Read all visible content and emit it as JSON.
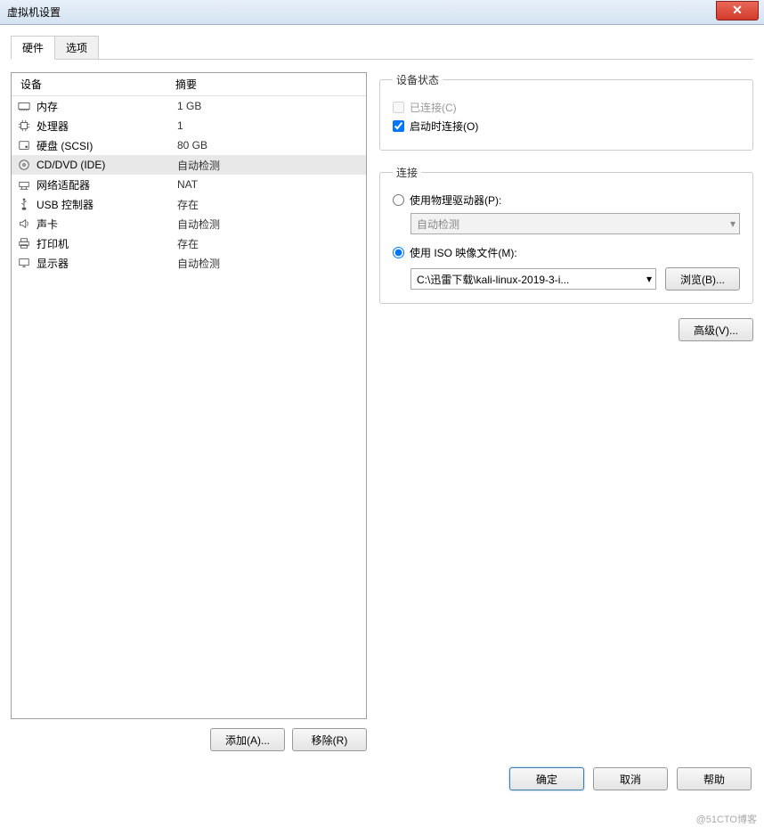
{
  "window": {
    "title": "虚拟机设置"
  },
  "tabs": {
    "hardware": "硬件",
    "options": "选项"
  },
  "hw_list": {
    "header_device": "设备",
    "header_summary": "摘要",
    "items": [
      {
        "icon": "memory",
        "name": "内存",
        "summary": "1 GB"
      },
      {
        "icon": "cpu",
        "name": "处理器",
        "summary": "1"
      },
      {
        "icon": "disk",
        "name": "硬盘 (SCSI)",
        "summary": "80 GB"
      },
      {
        "icon": "cd",
        "name": "CD/DVD (IDE)",
        "summary": "自动检测",
        "selected": true
      },
      {
        "icon": "net",
        "name": "网络适配器",
        "summary": "NAT"
      },
      {
        "icon": "usb",
        "name": "USB 控制器",
        "summary": "存在"
      },
      {
        "icon": "sound",
        "name": "声卡",
        "summary": "自动检测"
      },
      {
        "icon": "printer",
        "name": "打印机",
        "summary": "存在"
      },
      {
        "icon": "display",
        "name": "显示器",
        "summary": "自动检测"
      }
    ]
  },
  "buttons": {
    "add": "添加(A)...",
    "remove": "移除(R)",
    "browse": "浏览(B)...",
    "advanced": "高级(V)...",
    "ok": "确定",
    "cancel": "取消",
    "help": "帮助"
  },
  "device_status": {
    "legend": "设备状态",
    "connected": "已连接(C)",
    "connect_at_poweron": "启动时连接(O)"
  },
  "connection": {
    "legend": "连接",
    "physical": "使用物理驱动器(P):",
    "physical_value": "自动检测",
    "iso": "使用 ISO 映像文件(M):",
    "iso_path": "C:\\迅雷下载\\kali-linux-2019-3-i..."
  },
  "watermark": "@51CTO博客"
}
